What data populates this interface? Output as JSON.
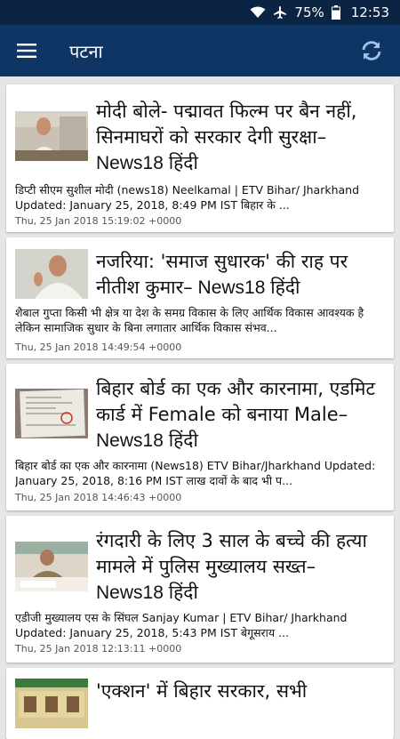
{
  "status": {
    "battery": "75%",
    "time": "12:53"
  },
  "appbar": {
    "title": "पटना"
  },
  "icons": {
    "menu": "hamburger-menu-icon",
    "refresh": "refresh-icon",
    "wifi": "wifi-icon",
    "airplane": "airplane-mode-icon",
    "battery": "battery-icon"
  },
  "colors": {
    "appbar": "#0e3563",
    "statusbar": "#0b2444",
    "background": "#e6e6e6"
  },
  "articles": [
    {
      "headline": "मोदी बोले- पद्मावत फिल्म पर बैन नहीं, सिनमाघरों को सरकार देगी सुरक्षा–",
      "source": " News18 हिंदी",
      "summary": "डिप्टी सीएम सुशील मोदी (news18)  Neelkamal | ETV Bihar/ Jharkhand Updated: January 25, 2018, 8:49 PM IST  बिहार के ...",
      "date": "Thu, 25 Jan 2018 15:19:02 +0000"
    },
    {
      "headline": "नजरिया: 'समाज सुधारक' की राह पर नीतीश कुमार–",
      "source": " News18 हिंदी",
      "summary": "शैबाल गुप्ता  किसी भी क्षेत्र या देश के समग्र विकास के लिए आर्थिक विकास आवश्यक है लेकिन सामाजिक सुधार के बिना लगातार आर्थिक विकास संभव...",
      "date": "Thu, 25 Jan 2018 14:49:54 +0000"
    },
    {
      "headline": "बिहार बोर्ड का एक और कारनामा, एडमिट कार्ड में Female को बनाया Male–",
      "source": " News18 हिंदी",
      "summary": "बिहार बोर्ड का एक और कारनामा (News18)  ETV Bihar/Jharkhand Updated: January 25, 2018, 8:16 PM IST  लाख दावों के बाद भी प...",
      "date": "Thu, 25 Jan 2018 14:46:43 +0000"
    },
    {
      "headline": "रंगदारी के लिए 3 साल के बच्चे की हत्या मामले में पुलिस मुख्यालय सख्त–",
      "source": " News18 हिंदी",
      "summary": "एडीजी मुख्यालय एस के सिंघल  Sanjay Kumar | ETV Bihar/ Jharkhand Updated: January 25, 2018, 5:43 PM IST  बेगूसराय ...",
      "date": "Thu, 25 Jan 2018 12:13:11 +0000"
    },
    {
      "headline": "'एक्शन' में बिहार सरकार, सभी",
      "source": "",
      "summary": "",
      "date": ""
    }
  ]
}
